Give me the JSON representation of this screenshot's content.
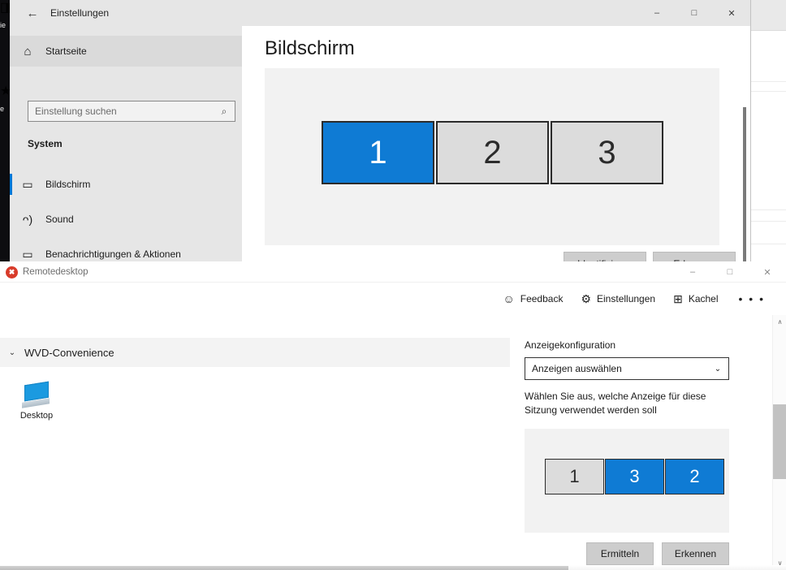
{
  "desktop": {
    "icons": [
      {
        "name": "desktop-shortcut-1",
        "glyph": "◨",
        "label": "ie"
      },
      {
        "name": "desktop-shortcut-2",
        "glyph": "★",
        "label": "e"
      }
    ]
  },
  "settings_window": {
    "title": "Einstellungen",
    "back_icon": "←",
    "controls": {
      "minimize": "–",
      "maximize": "□",
      "close": "✕"
    },
    "sidebar": {
      "home": {
        "label": "Startseite",
        "icon": "⌂"
      },
      "search": {
        "placeholder": "Einstellung suchen",
        "value": "",
        "icon": "⌕"
      },
      "group_label": "System",
      "items": [
        {
          "label": "Bildschirm",
          "icon": "▭",
          "selected": true
        },
        {
          "label": "Sound",
          "icon": "ᴖ)",
          "selected": false
        },
        {
          "label": "Benachrichtigungen & Aktionen",
          "icon": "▭",
          "selected": false
        }
      ]
    },
    "page_title": "Bildschirm",
    "monitors": [
      {
        "number": "1",
        "selected": true
      },
      {
        "number": "2",
        "selected": false
      },
      {
        "number": "3",
        "selected": false
      }
    ],
    "buttons": [
      {
        "label": "Identifizieren"
      },
      {
        "label": "Erkennen"
      }
    ]
  },
  "remote_desktop": {
    "title": "Remotedesktop",
    "app_icon_glyph": "✖",
    "controls": {
      "minimize": "–",
      "maximize": "□",
      "close": "✕"
    },
    "toolbar": [
      {
        "label": "Feedback",
        "icon": "☺"
      },
      {
        "label": "Einstellungen",
        "icon": "⚙"
      },
      {
        "label": "Kachel",
        "icon": "⊞"
      }
    ],
    "toolbar_overflow": "• • •",
    "group": {
      "label": "WVD-Convenience",
      "chevron": "⌄"
    },
    "resources": [
      {
        "label": "Desktop",
        "icon": "monitor-icon"
      }
    ]
  },
  "flyout": {
    "heading": "Anzeigekonfiguration",
    "select": {
      "value": "Anzeigen auswählen",
      "chevron": "⌄"
    },
    "help_text": "Wählen Sie aus, welche Anzeige für diese Sitzung verwendet werden soll",
    "monitors": [
      {
        "number": "1",
        "selected": false
      },
      {
        "number": "3",
        "selected": true
      },
      {
        "number": "2",
        "selected": true
      }
    ],
    "buttons": [
      {
        "label": "Ermitteln"
      },
      {
        "label": "Erkennen"
      }
    ],
    "scrollbar": {
      "up": "∧",
      "down": "∨"
    }
  },
  "colors": {
    "accent_blue": "#0f7bd4",
    "selection_blue": "#0078d7",
    "monitor_off": "#dcdcdc",
    "settings_chrome": "#e6e6e6",
    "rd_icon_red": "#d83b2a"
  }
}
